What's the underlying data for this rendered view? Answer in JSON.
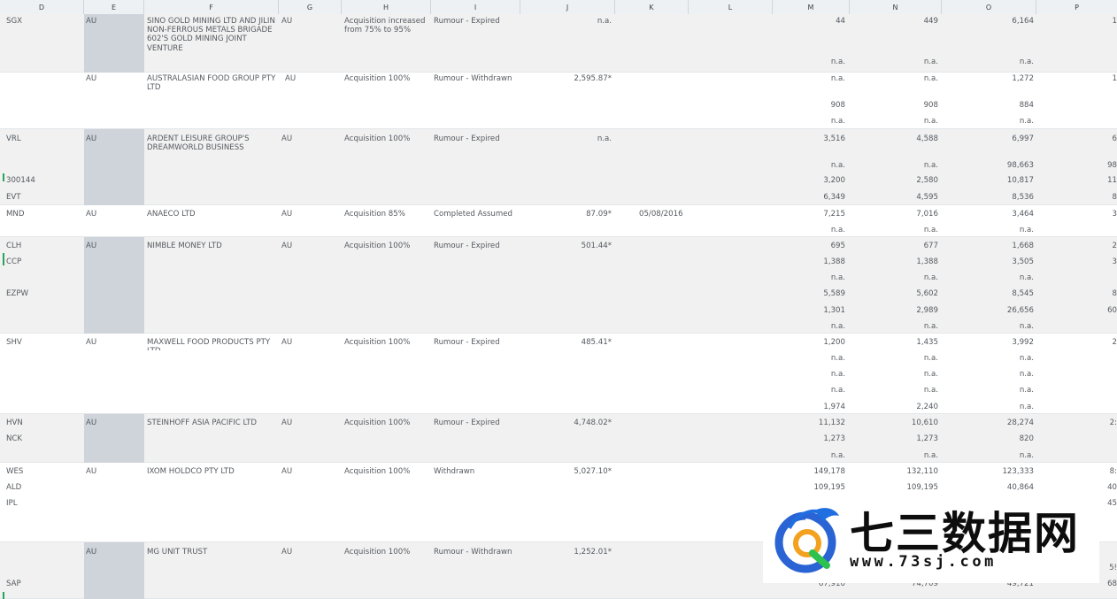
{
  "columns": [
    "D",
    "E",
    "F",
    "G",
    "H",
    "I",
    "J",
    "K",
    "L",
    "M",
    "N",
    "O",
    "P"
  ],
  "rows": [
    {
      "d": "SGX",
      "e": "AU",
      "f": "SINO GOLD MINING LTD AND JILIN NON-FERROUS METALS BRIGADE 602'S GOLD MINING JOINT VENTURE",
      "g": "AU",
      "h": "Acquisition increased from 75% to 95%",
      "i": "Rumour - Expired",
      "j": "n.a.",
      "k": "",
      "m": [
        "44",
        "n.a."
      ],
      "n": [
        "449",
        "n.a."
      ],
      "o": [
        "6,164",
        "n.a."
      ],
      "p": [
        "1",
        ""
      ]
    },
    {
      "d": "",
      "e": "AU",
      "f": "AUSTRALASIAN FOOD GROUP PTY LTD",
      "g": "AU",
      "h": "Acquisition 100%",
      "i": "Rumour - Withdrawn",
      "j": "2,595.87*",
      "k": "",
      "m": [
        "n.a.",
        "908",
        "n.a."
      ],
      "n": [
        "n.a.",
        "908",
        "n.a."
      ],
      "o": [
        "1,272",
        "884",
        "n.a."
      ],
      "p": [
        "1",
        "",
        ""
      ]
    },
    {
      "d": "VRL",
      "e": "AU",
      "f": "ARDENT LEISURE GROUP'S DREAMWORLD BUSINESS",
      "g": "AU",
      "h": "Acquisition 100%",
      "i": "Rumour - Expired",
      "j": "n.a.",
      "k": "",
      "m": [
        "3,516",
        "n.a.",
        "3,200",
        "6,349"
      ],
      "n": [
        "4,588",
        "n.a.",
        "2,580",
        "4,595"
      ],
      "o": [
        "6,997",
        "98,663",
        "10,817",
        "8,536"
      ],
      "p": [
        "6",
        "98",
        "11",
        "8"
      ],
      "d2": [
        "300144",
        "EVT"
      ]
    },
    {
      "d": "MND",
      "e": "AU",
      "f": "ANAECO LTD",
      "g": "AU",
      "h": "Acquisition 85%",
      "i": "Completed Assumed",
      "j": "87.09*",
      "k": "05/08/2016",
      "m": [
        "7,215",
        "n.a."
      ],
      "n": [
        "7,016",
        "n.a."
      ],
      "o": [
        "3,464",
        "n.a."
      ],
      "p": [
        "3",
        ""
      ]
    },
    {
      "d": "CLH",
      "e": "AU",
      "f": "NIMBLE MONEY LTD",
      "g": "AU",
      "h": "Acquisition 100%",
      "i": "Rumour - Expired",
      "j": "501.44*",
      "k": "",
      "m": [
        "695",
        "1,388",
        "n.a.",
        "5,589",
        "1,301",
        "n.a."
      ],
      "n": [
        "677",
        "1,388",
        "n.a.",
        "5,602",
        "2,989",
        "n.a."
      ],
      "o": [
        "1,668",
        "3,505",
        "n.a.",
        "8,545",
        "26,656",
        "n.a."
      ],
      "p": [
        "2",
        "3",
        "",
        "8",
        "60",
        ""
      ],
      "d2": [
        "CCP",
        "EZPW"
      ]
    },
    {
      "d": "SHV",
      "e": "AU",
      "f": "MAXWELL FOOD PRODUCTS PTY LTD",
      "g": "AU",
      "h": "Acquisition 100%",
      "i": "Rumour - Expired",
      "j": "485.41*",
      "k": "",
      "m": [
        "1,200",
        "n.a.",
        "n.a.",
        "n.a.",
        "1,974"
      ],
      "n": [
        "1,435",
        "n.a.",
        "n.a.",
        "n.a.",
        "2,240"
      ],
      "o": [
        "3,992",
        "n.a.",
        "n.a.",
        "n.a.",
        "n.a."
      ],
      "p": [
        "2",
        "",
        "",
        "",
        ""
      ]
    },
    {
      "d": "HVN",
      "e": "AU",
      "f": "STEINHOFF ASIA PACIFIC LTD",
      "g": "AU",
      "h": "Acquisition 100%",
      "i": "Rumour - Expired",
      "j": "4,748.02*",
      "k": "",
      "m": [
        "11,132",
        "1,273",
        "n.a."
      ],
      "n": [
        "10,610",
        "1,273",
        "n.a."
      ],
      "o": [
        "28,274",
        "820",
        "n.a."
      ],
      "p": [
        "2:",
        "",
        ""
      ],
      "d2": [
        "NCK"
      ]
    },
    {
      "d": "WES",
      "e": "AU",
      "f": "IXOM HOLDCO PTY LTD",
      "g": "AU",
      "h": "Acquisition 100%",
      "i": "Withdrawn",
      "j": "5,027.10*",
      "k": "",
      "m": [
        "149,178",
        "109,195"
      ],
      "n": [
        "132,110",
        "109,195"
      ],
      "o": [
        "123,333",
        "40,864"
      ],
      "p": [
        "8:",
        "40",
        "45"
      ],
      "d2": [
        "ALD",
        "IPL"
      ]
    },
    {
      "d": "",
      "e": "AU",
      "f": "MG UNIT TRUST",
      "g": "AU",
      "h": "Acquisition 100%",
      "i": "Rumour - Withdrawn",
      "j": "1,252.01*",
      "k": "",
      "m": [
        "",
        "67,910"
      ],
      "n": [
        "",
        "74,709"
      ],
      "o": [
        "",
        "49,721"
      ],
      "p": [
        "5!",
        "68"
      ],
      "d2": [
        "SAP"
      ]
    }
  ],
  "watermark": {
    "cn": "七三数据网",
    "url": "www.73sj.com"
  }
}
